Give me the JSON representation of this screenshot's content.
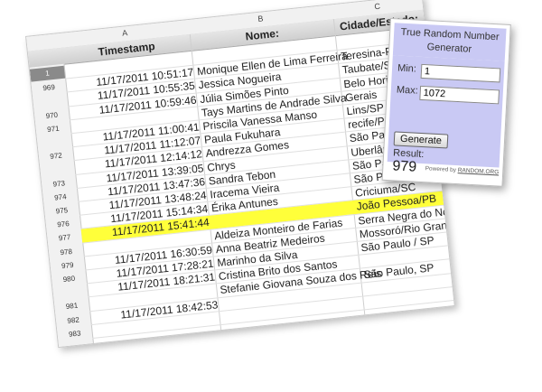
{
  "sheet": {
    "col_letters": [
      "A",
      "B",
      "C"
    ],
    "headers": {
      "timestamp": "Timestamp",
      "name": "Nome:",
      "city": "Cidade/Estado:"
    },
    "rows": [
      {
        "num": "1",
        "ts": "",
        "name": "",
        "city": ""
      },
      {
        "num": "969",
        "ts": "11/17/2011 10:51:17",
        "name": "Monique Ellen de Lima Ferreira",
        "city": "Teresina-PI"
      },
      {
        "num": "",
        "ts": "11/17/2011 10:55:35",
        "name": "Jessica Nogueira",
        "city": "Taubate/SP"
      },
      {
        "num": "970",
        "ts": "11/17/2011 10:59:46",
        "name": "Júlia Simões Pinto",
        "city": "Belo Horizonte- MG"
      },
      {
        "num": "971",
        "ts": "",
        "name": "Tays Martins de Andrade Silva",
        "city": "Gerais"
      },
      {
        "num": "",
        "ts": "11/17/2011 11:00:41",
        "name": "Priscila Vanessa Manso",
        "city": "Lins/SP"
      },
      {
        "num": "972",
        "ts": "11/17/2011 11:12:07",
        "name": "Paula Fukuhara",
        "city": "recife/PE"
      },
      {
        "num": "",
        "ts": "11/17/2011 12:14:12",
        "name": "Andrezza Gomes",
        "city": "São Paulo"
      },
      {
        "num": "973",
        "ts": "11/17/2011 13:39:05",
        "name": "Chrys",
        "city": "Uberlând"
      },
      {
        "num": "974",
        "ts": "11/17/2011 13:47:36",
        "name": "Sandra Tebon",
        "city": "São Paulo/SP"
      },
      {
        "num": "975",
        "ts": "11/17/2011 13:48:24",
        "name": "Iracema Vieira",
        "city": "São Paulo/SP"
      },
      {
        "num": "976",
        "ts": "11/17/2011 15:14:34",
        "name": "Érika Antunes",
        "city": "Criciuma/SC"
      },
      {
        "num": "977",
        "ts": "11/17/2011 15:41:44",
        "name": "",
        "city": "João Pessoa/PB"
      },
      {
        "num": "978",
        "ts": "",
        "name": "Aldeiza Monteiro de Farias",
        "city": "Serra Negra do Norte - RN"
      },
      {
        "num": "979",
        "ts": "11/17/2011 16:30:59",
        "name": "Anna Beatriz Medeiros",
        "city": "Mossoró/Rio Grande do Norte"
      },
      {
        "num": "980",
        "ts": "11/17/2011 17:28:21",
        "name": "Marinho da Silva",
        "city": "São Paulo / SP"
      },
      {
        "num": "",
        "ts": "11/17/2011 18:21:31",
        "name": "Cristina Brito dos Santos",
        "city": ""
      },
      {
        "num": "981",
        "ts": "",
        "name": "Stefanie Giovana Souza dos Reis",
        "city": "São Paulo, SP"
      },
      {
        "num": "982",
        "ts": "11/17/2011 18:42:53",
        "name": "",
        "city": ""
      },
      {
        "num": "983",
        "ts": "",
        "name": "",
        "city": ""
      }
    ]
  },
  "widget": {
    "title": "True Random Number Generator",
    "min_label": "Min:",
    "min_value": "1",
    "max_label": "Max:",
    "max_value": "1072",
    "button_label": "Generate",
    "result_label": "Result:",
    "result_value": "979",
    "footer_prefix": "Powered by",
    "footer_link": "RANDOM.ORG"
  },
  "colors": {
    "highlight": "#ffff3a",
    "widget_bg": "#c9c9f4"
  }
}
